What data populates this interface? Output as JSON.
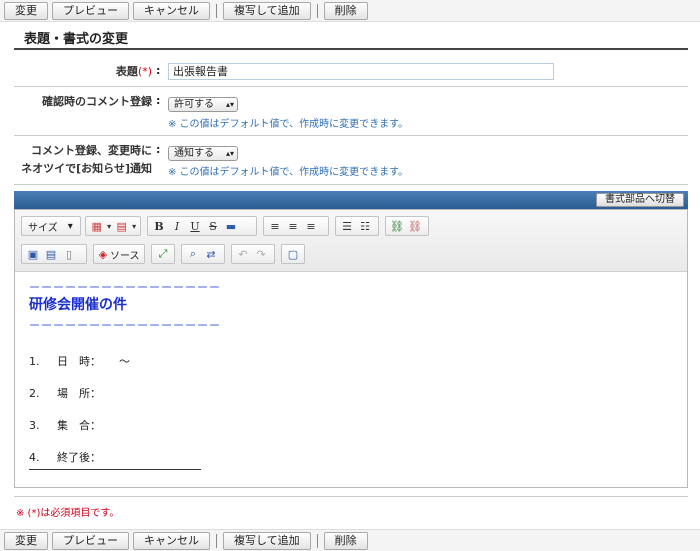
{
  "toolbar": {
    "change": "変更",
    "preview": "プレビュー",
    "cancel": "キャンセル",
    "copy_add": "複写して追加",
    "delete": "削除"
  },
  "page_title": "表題・書式の変更",
  "form": {
    "subject_label": "表題",
    "required_mark": "(*)",
    "subject_value": "出張報告書",
    "comment_label": "確認時のコメント登録",
    "comment_select": "許可する",
    "comment_hint": "※ この値はデフォルト値で、作成時に変更できます。",
    "notify_label_line1": "コメント登録、変更時に",
    "notify_label_line2": "ネオツイで[お知らせ]通知",
    "notify_select": "通知する",
    "notify_hint": "※ この値はデフォルト値で、作成時に変更できます。"
  },
  "editor": {
    "switch_button": "書式部品へ切替",
    "size_label": "サイズ",
    "source_label": "ソース",
    "dash_line": "ーーーーーーーーーーーーーーーー",
    "doc_title": "研修会開催の件",
    "items": [
      {
        "num": "1.",
        "label": "日　時：",
        "value": "～"
      },
      {
        "num": "2.",
        "label": "場　所：",
        "value": ""
      },
      {
        "num": "3.",
        "label": "集　合：",
        "value": ""
      },
      {
        "num": "4.",
        "label": "終了後：",
        "value": ""
      }
    ]
  },
  "required_note": "※ (*)は必須項目です。"
}
